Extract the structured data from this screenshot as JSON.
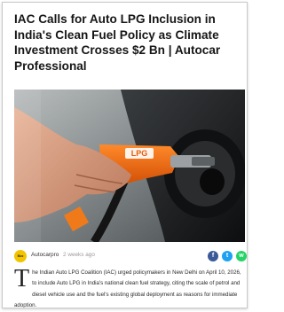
{
  "article": {
    "title": "IAC Calls for Auto LPG Inclusion in India's Clean Fuel Policy as Climate Investment Crosses $2 Bn | Autocar Professional",
    "source_logo_text": "Bizz",
    "source_name": "Autocarpro",
    "separator": "·",
    "time_ago": "2 weeks ago",
    "dropcap": "T",
    "body": "he Indian Auto LPG Coalition (IAC) urged policymakers in New Delhi on April 10, 2026, to include Auto LPG in India's national clean fuel strategy, citing the scale of petrol and diesel vehicle use and the fuel's existing global deployment as reasons for immediate adoption."
  },
  "share": {
    "facebook_icon": "f",
    "twitter_icon": "t",
    "whatsapp_icon": "w"
  },
  "hero_image": {
    "nozzle_label": "LPG",
    "colors": {
      "nozzle": "#f06a12",
      "car": "#1e2022",
      "background": "#8a8f91"
    }
  },
  "colors": {
    "avatar": "#f2c400",
    "facebook": "#3b5998",
    "twitter": "#1da1f2",
    "whatsapp": "#25d366"
  }
}
